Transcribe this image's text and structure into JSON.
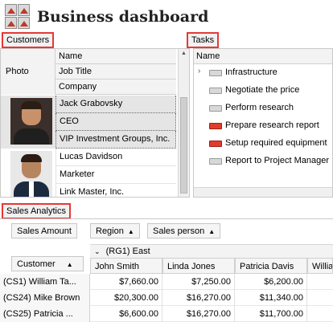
{
  "app": {
    "title": "Business dashboard",
    "icon": "business-dashboard-icon"
  },
  "customers": {
    "panel_label": "Customers",
    "columns": {
      "photo": "Photo",
      "name": "Name",
      "job_title": "Job Title",
      "company": "Company"
    },
    "rows": [
      {
        "name": "Jack Grabovsky",
        "job_title": "CEO",
        "company": "VIP Investment Groups, Inc."
      },
      {
        "name": "Lucas Davidson",
        "job_title": "Marketer",
        "company": "Link Master, Inc."
      }
    ]
  },
  "tasks": {
    "panel_label": "Tasks",
    "column": "Name",
    "items": [
      {
        "name": "Infrastructure",
        "icon": "task-gray-icon",
        "expandable": true
      },
      {
        "name": "Negotiate the price",
        "icon": "task-gray-icon"
      },
      {
        "name": "Perform research",
        "icon": "task-gray-icon"
      },
      {
        "name": "Prepare research report",
        "icon": "task-red-icon"
      },
      {
        "name": "Setup required equipment",
        "icon": "task-red-icon"
      },
      {
        "name": "Report to Project Manager",
        "icon": "task-gray-icon"
      }
    ]
  },
  "sales": {
    "panel_label": "Sales Analytics",
    "data_field": "Sales Amount",
    "column_fields": [
      "Region",
      "Sales person"
    ],
    "row_field": "Customer",
    "group": "(RG1) East",
    "columns": [
      "John Smith",
      "Linda Jones",
      "Patricia Davis",
      "Willia"
    ],
    "rows": [
      {
        "customer": "(CS1) William Ta...",
        "values": [
          "$7,660.00",
          "$7,250.00",
          "$6,200.00"
        ]
      },
      {
        "customer": "(CS24) Mike Brown",
        "values": [
          "$20,300.00",
          "$16,270.00",
          "$11,340.00"
        ]
      },
      {
        "customer": "(CS25) Patricia ...",
        "values": [
          "$6,600.00",
          "$16,270.00",
          "$11,700.00"
        ]
      }
    ]
  }
}
